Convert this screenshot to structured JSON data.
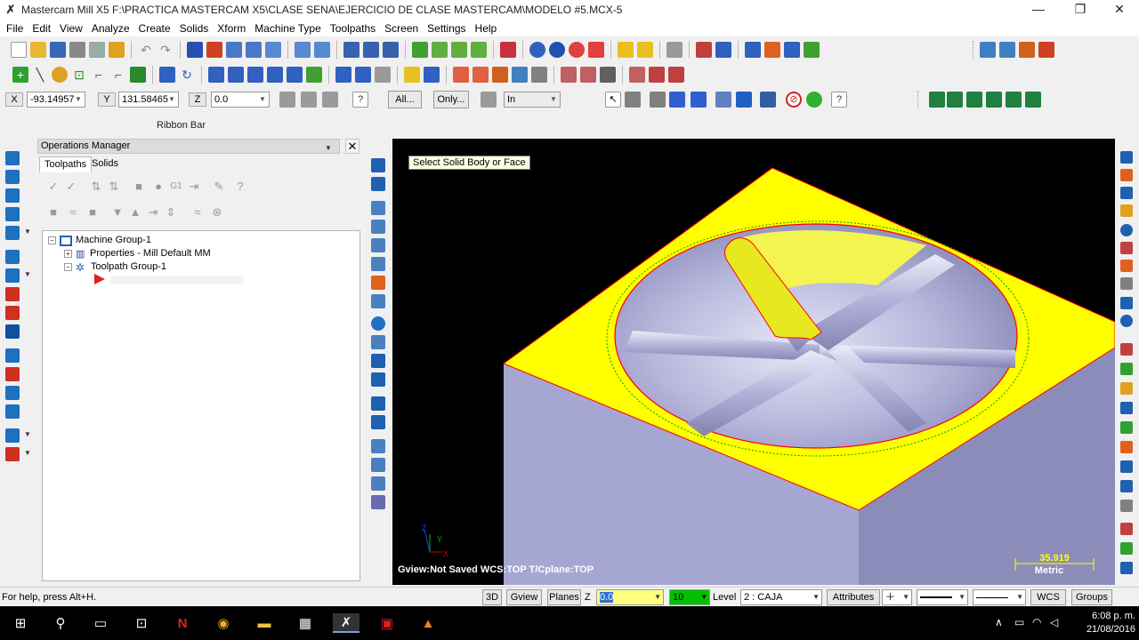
{
  "window": {
    "title": "Mastercam Mill X5  F:\\PRACTICA MASTERCAM X5\\CLASE SENA\\EJERCICIO DE CLASE MASTERCAM\\MODELO #5.MCX-5",
    "minimize": "—",
    "maximize": "❐",
    "close": "✕"
  },
  "menu": [
    "File",
    "Edit",
    "View",
    "Analyze",
    "Create",
    "Solids",
    "Xform",
    "Machine Type",
    "Toolpaths",
    "Screen",
    "Settings",
    "Help"
  ],
  "ribbon": {
    "x_label": "X",
    "x_value": "-93.14957",
    "y_label": "Y",
    "y_value": "131.58465",
    "z_label": "Z",
    "z_value": "0.0",
    "all_button": "All...",
    "only_button": "Only...",
    "mode_value": "In",
    "bar_label": "Ribbon Bar"
  },
  "operations_manager": {
    "title": "Operations Manager",
    "close": "✕",
    "tabs": [
      "Toolpaths",
      "Solids"
    ],
    "tree": {
      "machine_group": "Machine Group-1",
      "properties": "Properties - Mill Default MM",
      "toolpath_group": "Toolpath Group-1"
    }
  },
  "viewport": {
    "tooltip": "Select Solid Body or Face",
    "status": "Gview:Not Saved   WCS:TOP   T/Cplane:TOP",
    "scale_value": "35.919",
    "scale_unit": "Metric",
    "axis_labels": {
      "z": "Z",
      "y": "Y",
      "x": "X"
    },
    "colors": {
      "background": "#000000",
      "top_face": "#ffff00",
      "side_face": "#a9a9d2",
      "pocket": "#b2b2dc",
      "edge": "#ff0000",
      "circle": "#00a000"
    }
  },
  "statusbar": {
    "help": "For help, press Alt+H.",
    "btn_3d": "3D",
    "btn_gview": "Gview",
    "btn_planes": "Planes",
    "z_label": "Z",
    "z_value": "0.0",
    "color_value": "10",
    "level_label": "Level",
    "level_value": "2 : CAJA",
    "attributes": "Attributes",
    "wcs": "WCS",
    "groups": "Groups"
  },
  "taskbar": {
    "time": "6:08 p. m.",
    "date": "21/08/2016"
  }
}
